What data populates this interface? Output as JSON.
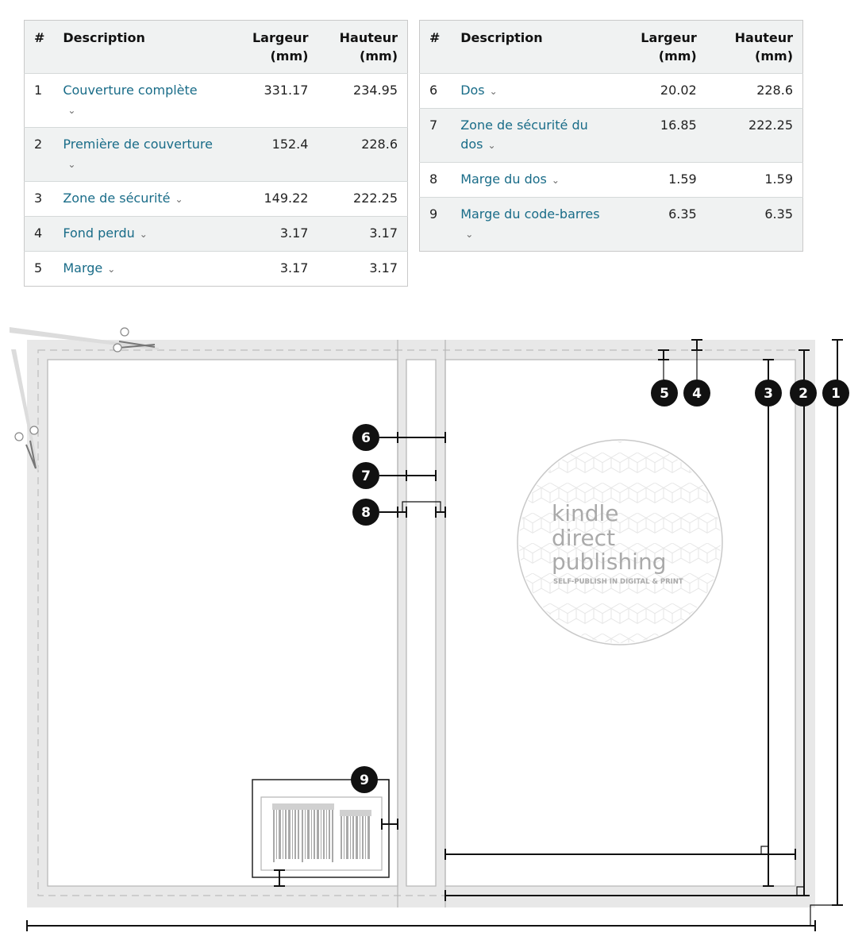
{
  "headers": {
    "index": "#",
    "description": "Description",
    "width_line1": "Largeur",
    "width_line2": "(mm)",
    "height_line1": "Hauteur",
    "height_line2": "(mm)"
  },
  "rows_left": [
    {
      "index": "1",
      "description": "Couverture complète",
      "width": "331.17",
      "height": "234.95"
    },
    {
      "index": "2",
      "description": "Première de couverture",
      "width": "152.4",
      "height": "228.6"
    },
    {
      "index": "3",
      "description": "Zone de sécurité",
      "width": "149.22",
      "height": "222.25"
    },
    {
      "index": "4",
      "description": "Fond perdu",
      "width": "3.17",
      "height": "3.17"
    },
    {
      "index": "5",
      "description": "Marge",
      "width": "3.17",
      "height": "3.17"
    }
  ],
  "rows_right": [
    {
      "index": "6",
      "description": "Dos",
      "width": "20.02",
      "height": "228.6"
    },
    {
      "index": "7",
      "description": "Zone de sécurité du dos",
      "width": "16.85",
      "height": "222.25"
    },
    {
      "index": "8",
      "description": "Marge du dos",
      "width": "1.59",
      "height": "1.59"
    },
    {
      "index": "9",
      "description": "Marge du code-barres",
      "width": "6.35",
      "height": "6.35"
    }
  ],
  "chevron_icon": "chevron-down-icon",
  "diagram": {
    "badges": [
      "1",
      "2",
      "3",
      "4",
      "5",
      "6",
      "7",
      "8",
      "9"
    ],
    "logo": {
      "line1": "kindle",
      "line2": "direct",
      "line3": "publishing",
      "tagline": "SELF-PUBLISH IN DIGITAL & PRINT"
    },
    "icons": [
      "scissors-icon",
      "scissors-icon",
      "barcode-icon"
    ]
  }
}
